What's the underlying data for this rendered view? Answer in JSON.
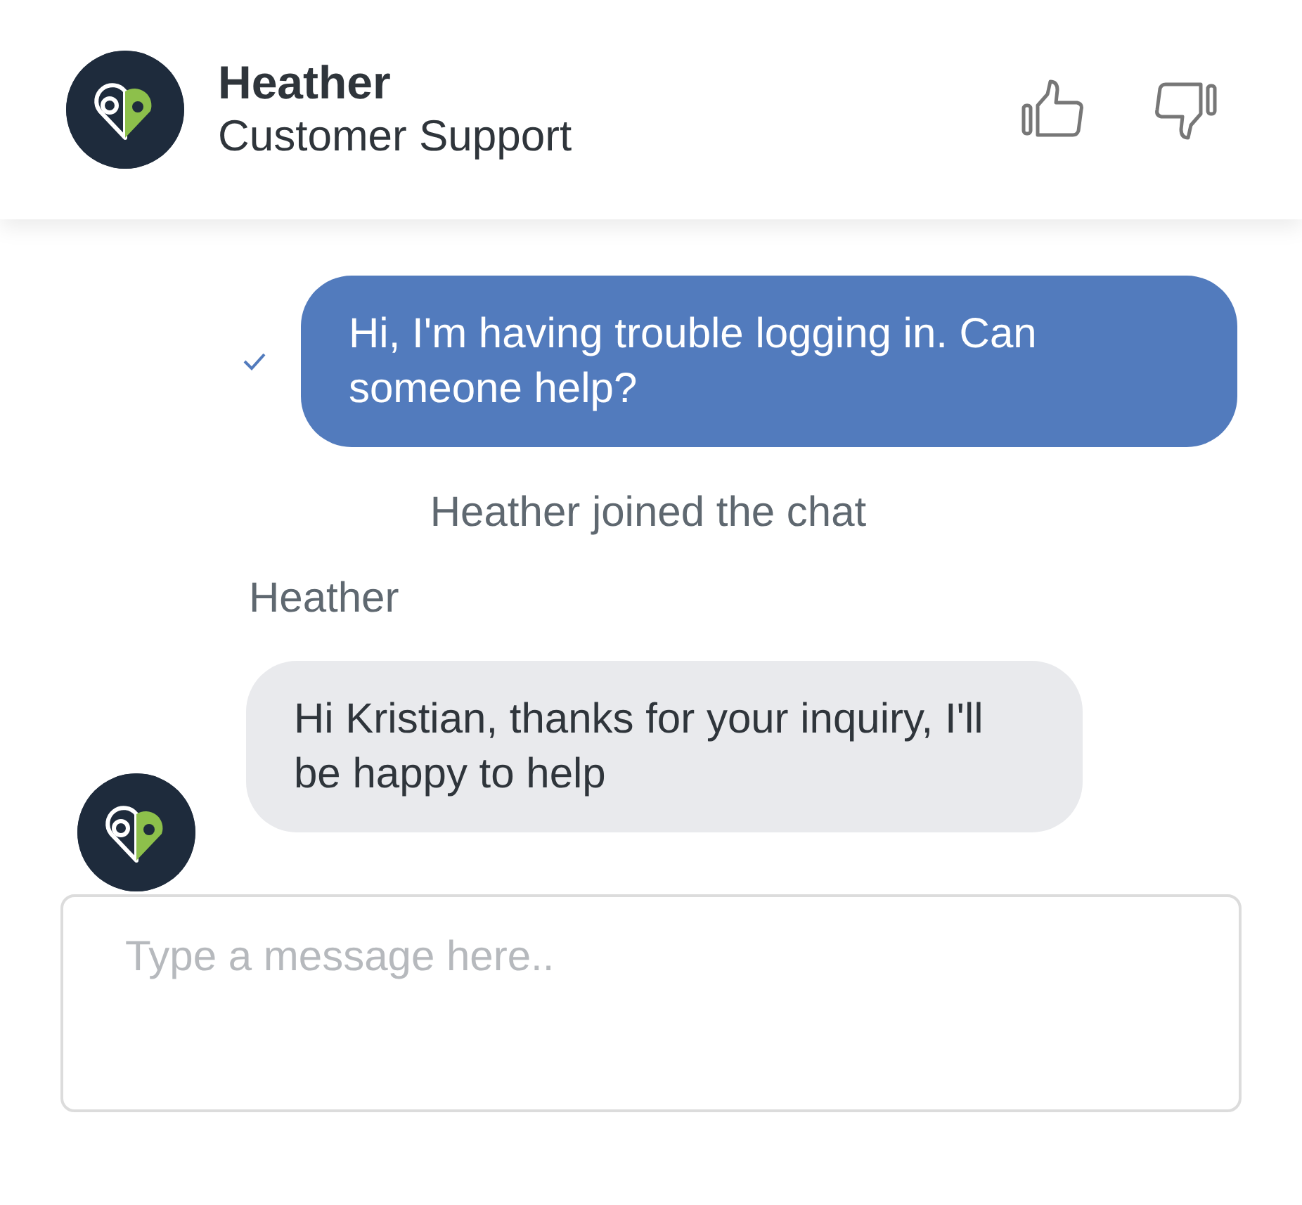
{
  "header": {
    "name": "Heather",
    "role": "Customer Support"
  },
  "messages": [
    {
      "kind": "outgoing",
      "text": "Hi, I'm having trouble logging in. Can someone help?",
      "delivered": true
    },
    {
      "kind": "system",
      "text": "Heather joined the chat"
    },
    {
      "kind": "incoming",
      "sender": "Heather",
      "text": "Hi Kristian, thanks for your inquiry, I'll be happy to help"
    }
  ],
  "composer": {
    "placeholder": "Type a message here.."
  }
}
